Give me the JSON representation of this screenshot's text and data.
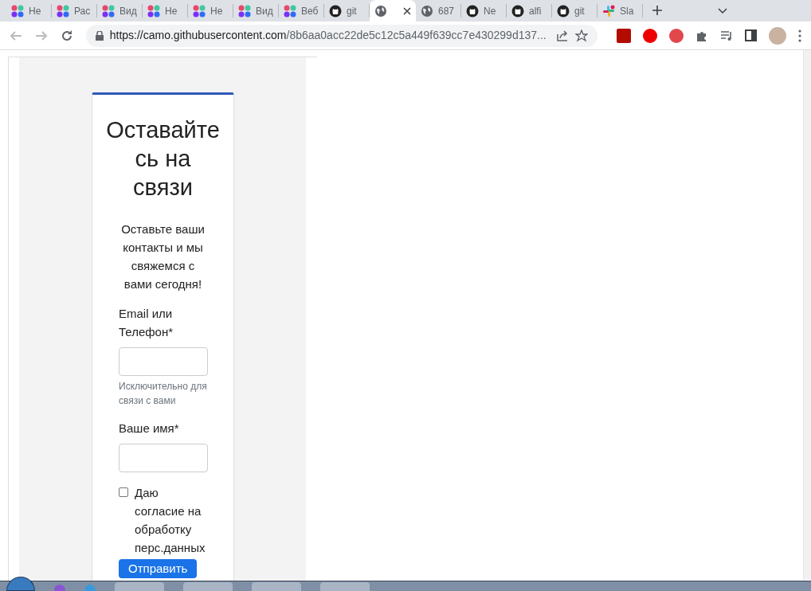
{
  "tabs": [
    {
      "label": "Не",
      "kind": "colorful",
      "selected": false
    },
    {
      "label": "Рас",
      "kind": "colorful",
      "selected": false
    },
    {
      "label": "Вид",
      "kind": "colorful",
      "selected": false
    },
    {
      "label": "Не",
      "kind": "colorful",
      "selected": false
    },
    {
      "label": "Не",
      "kind": "colorful",
      "selected": false
    },
    {
      "label": "Вид",
      "kind": "colorful",
      "selected": false
    },
    {
      "label": "Веб",
      "kind": "colorful",
      "selected": false
    },
    {
      "label": "git",
      "kind": "github",
      "selected": false
    },
    {
      "kind": "globe",
      "selected": true
    },
    {
      "label": "687",
      "kind": "globe",
      "selected": false
    },
    {
      "label": "Ne",
      "kind": "github",
      "selected": false
    },
    {
      "label": "alfi",
      "kind": "github",
      "selected": false
    },
    {
      "label": "git",
      "kind": "github",
      "selected": false
    },
    {
      "label": "Sla",
      "kind": "slack",
      "selected": false
    }
  ],
  "address_bar": {
    "host": "https://camo.githubusercontent.com",
    "path": "/8b6aa0acc22de5c12c5a449f639cc7e430299d137..."
  },
  "form": {
    "title": "Оставайтесь на связи",
    "subtitle": "Оставьте ваши контакты и мы свяжемся с вами сегодня!",
    "fields": [
      {
        "label": "Email или Телефон*",
        "help": "Исключительно для связи с вами"
      },
      {
        "label": "Ваше имя*"
      }
    ],
    "consent": {
      "label": "Даю согласие на обработку перс.данных",
      "checked": false
    },
    "submit": "Отправить"
  }
}
